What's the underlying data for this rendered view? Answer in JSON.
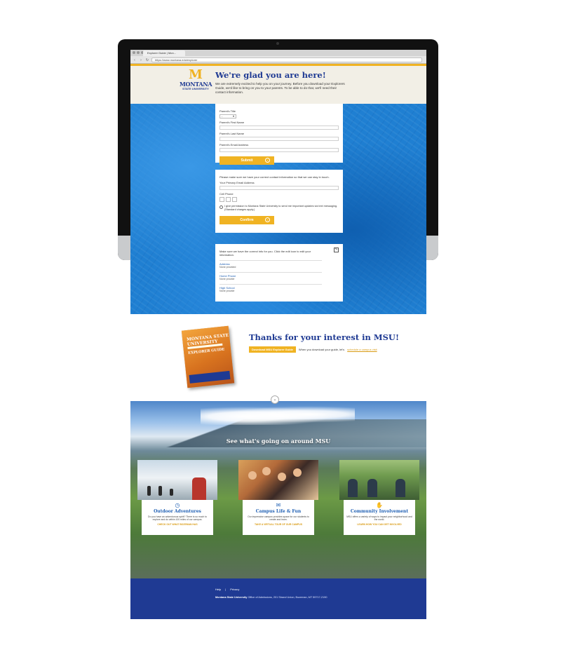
{
  "browser": {
    "tab_title": "Explorer Guide | Mon...",
    "url": "https://www.montana.edu/explorer",
    "nav_back": "‹",
    "nav_forward": "›",
    "nav_reload": "↻"
  },
  "header": {
    "logo_mark": "M",
    "logo_name": "MONTANA",
    "logo_sub": "STATE UNIVERSITY",
    "title": "We're glad you are here!",
    "intro": "We are extremely excited to help you on your journey. Before you download your Explorers Guide, we'd like to bring on you to your parents. To be able to do that, we'll need their contact information."
  },
  "parent_form": {
    "title_label": "Parent's Title",
    "title_value": "-",
    "first_label": "Parent's First Name",
    "last_label": "Parent's Last Name",
    "email_label": "Parent's Email Address",
    "submit": "Submit"
  },
  "contact_form": {
    "intro": "Please make sure we have your correct contact information so that we can stay in touch.",
    "email_label": "Your Primary Email Address",
    "phone_label": "Cell Phone",
    "consent": "I give permission to Montana State University to send me important updates via text messaging. (Standard charges apply.)",
    "confirm": "Confirm"
  },
  "info_card": {
    "intro": "Make sure we have the correct info for you. Click the edit icon to edit your information.",
    "items": [
      {
        "key": "Address",
        "value": "None provided"
      },
      {
        "key": "Home Phone",
        "value": "None provide"
      },
      {
        "key": "High School",
        "value": "None provide"
      }
    ]
  },
  "thanks": {
    "guide_title": "MONTANA STATE UNIVERSITY",
    "guide_sub": "EXPLORER GUIDE",
    "heading": "Thanks for your interest in MSU!",
    "download": "Download MSU Explorer Guide",
    "middle": "When you download your guide, let's",
    "link": "schedule a campus visit",
    "chevron": "⌄"
  },
  "campus": {
    "heading": "See what's going on around MSU",
    "tiles": [
      {
        "icon": "◷",
        "title": "Outdoor Adventures",
        "desc": "Do you have an adventurous spirit? There is so much to explore and do within 100 miles of our campus.",
        "link": "CHECK OUT WHAT BOZEMAN HAS"
      },
      {
        "icon": "✉",
        "title": "Campus Life & Fun",
        "desc": "Our impressive campus provides space for our students to create and learn.",
        "link": "TAKE A VIRTUAL TOUR OF OUR CAMPUS"
      },
      {
        "icon": "✋",
        "title": "Community Involvement",
        "desc": "MSU offers a variety of ways to impact your neighborhood and the world.",
        "link": "LEARN HOW YOU CAN GET INVOLVED"
      }
    ]
  },
  "footer": {
    "help": "Help",
    "privacy": "Privacy",
    "org": "Montana State University",
    "address": "Office of Admissions, 201 Strand Union, Bozeman, MT 59717-2190"
  },
  "colors": {
    "brand_blue": "#1f3a93",
    "gold": "#f0b323",
    "map_blue": "#1f7fd2"
  }
}
